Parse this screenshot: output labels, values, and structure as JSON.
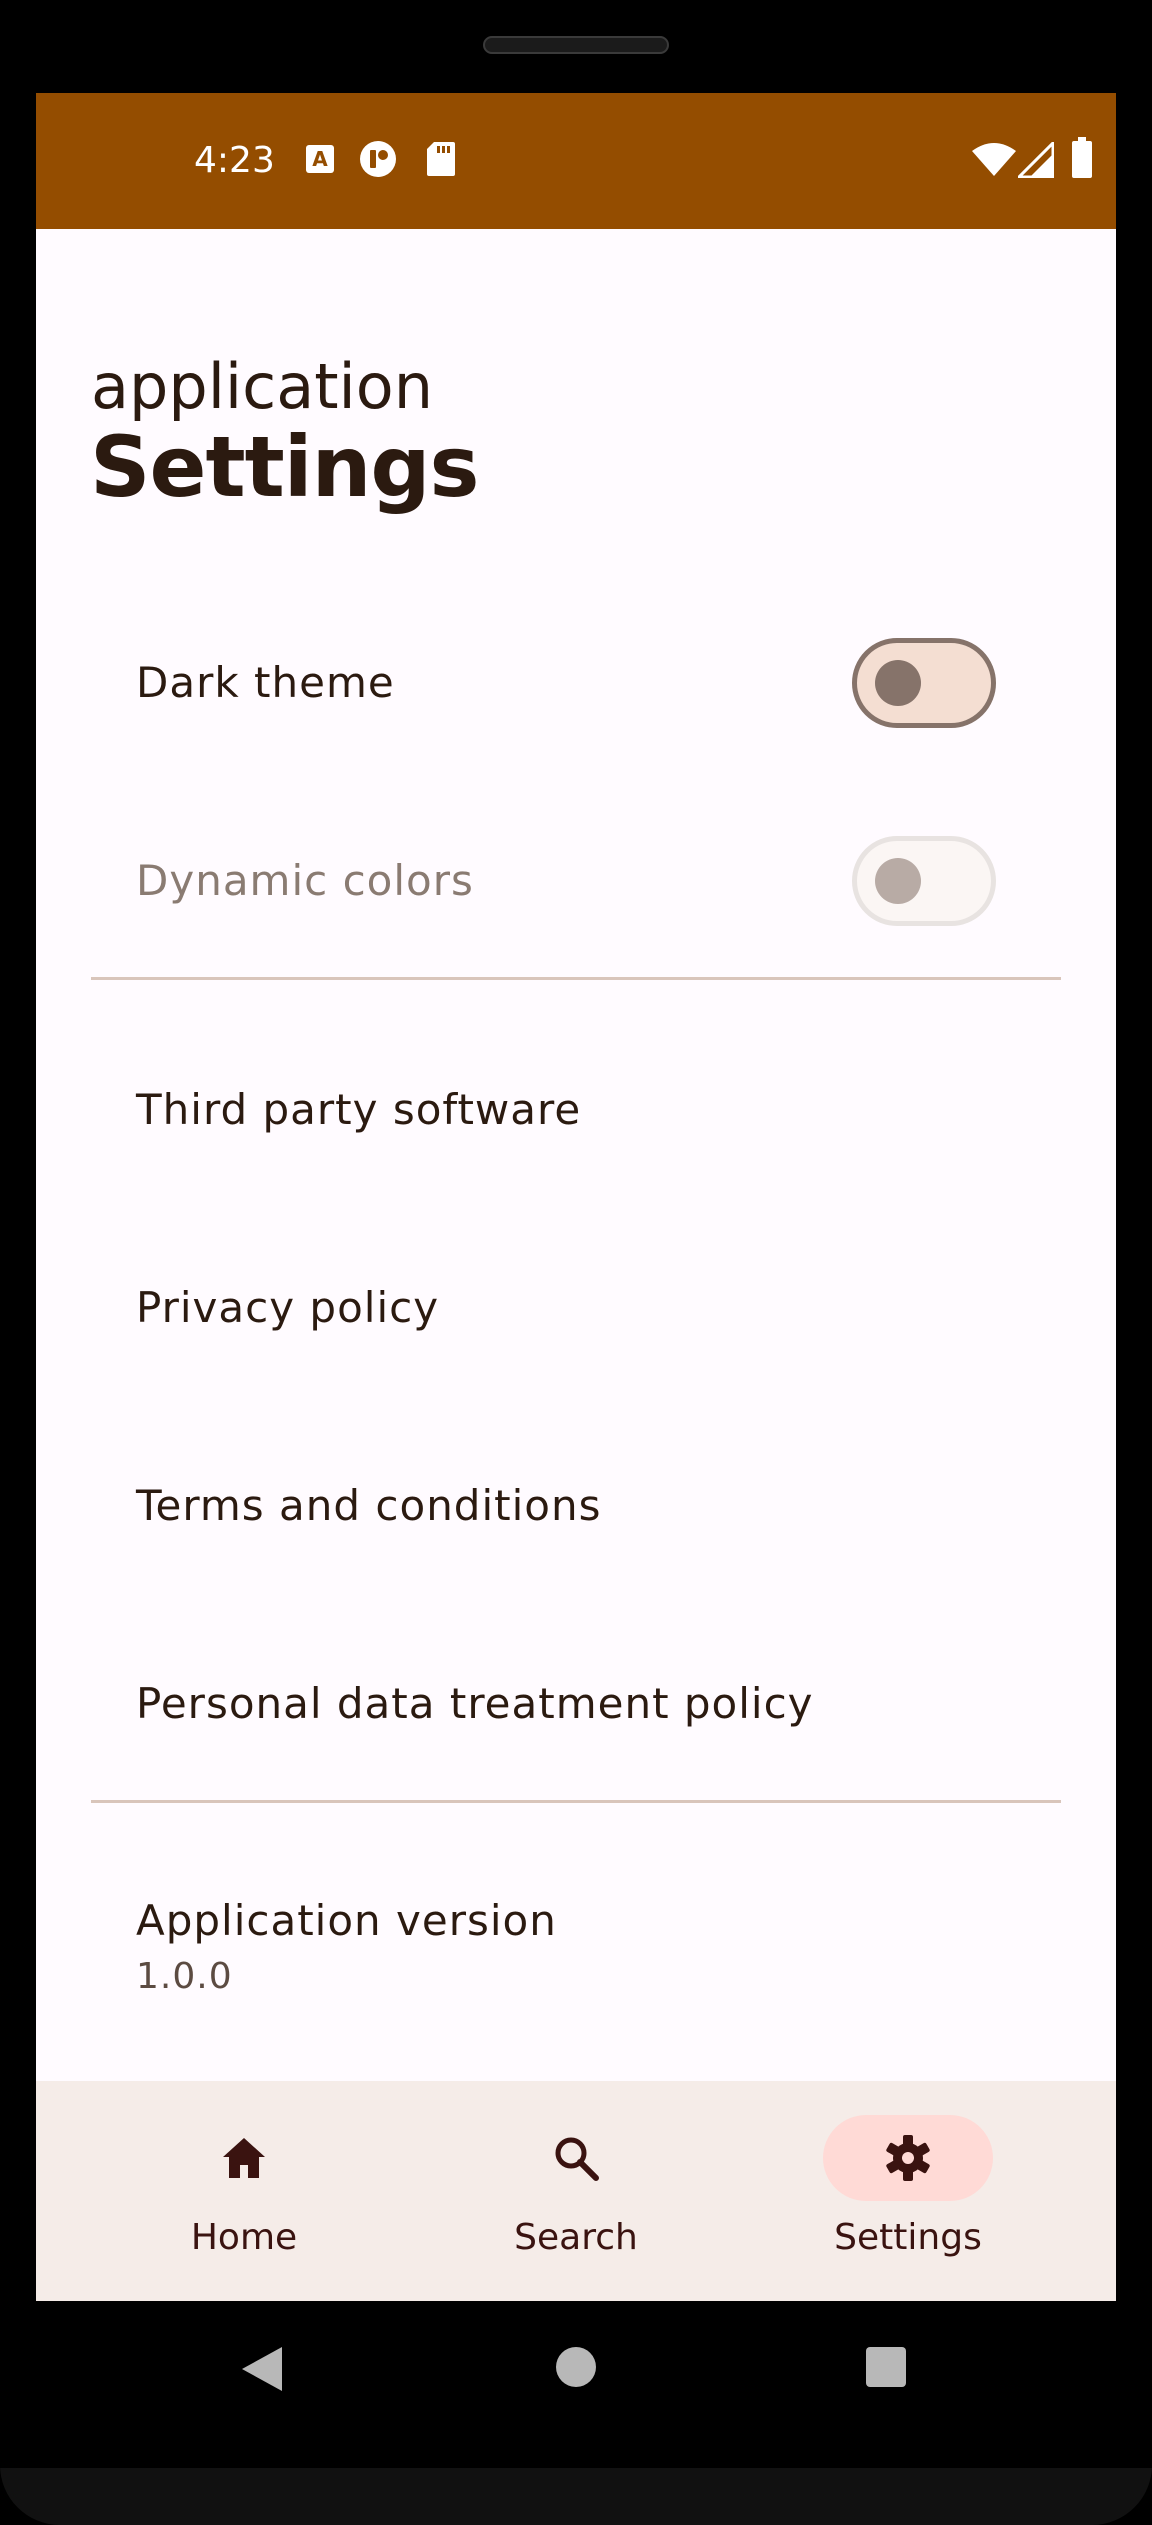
{
  "status_bar": {
    "time": "4:23",
    "icons": [
      "notification-a-icon",
      "notification-circle-icon",
      "sd-card-icon",
      "wifi-icon",
      "signal-icon",
      "battery-icon"
    ]
  },
  "header": {
    "subtitle": "application",
    "title": "Settings"
  },
  "toggles": [
    {
      "label": "Dark theme",
      "state": "off",
      "enabled": true
    },
    {
      "label": "Dynamic colors",
      "state": "off",
      "enabled": false
    }
  ],
  "links": [
    {
      "label": "Third party software"
    },
    {
      "label": "Privacy policy"
    },
    {
      "label": "Terms and conditions"
    },
    {
      "label": "Personal data treatment policy"
    }
  ],
  "version": {
    "label": "Application version",
    "value": "1.0.0"
  },
  "bottom_nav": {
    "items": [
      {
        "label": "Home",
        "icon": "home-icon",
        "active": false
      },
      {
        "label": "Search",
        "icon": "search-icon",
        "active": false
      },
      {
        "label": "Settings",
        "icon": "gear-icon",
        "active": true
      }
    ]
  },
  "system_nav": [
    "back-icon",
    "home-circle-icon",
    "recents-icon"
  ],
  "colors": {
    "status_bar": "#944D00",
    "background": "#FFFBFF",
    "text": "#2B1A10",
    "nav_background": "#F5ECE8",
    "nav_indicator": "#FFDAD6",
    "divider": "#D9C5BB"
  }
}
